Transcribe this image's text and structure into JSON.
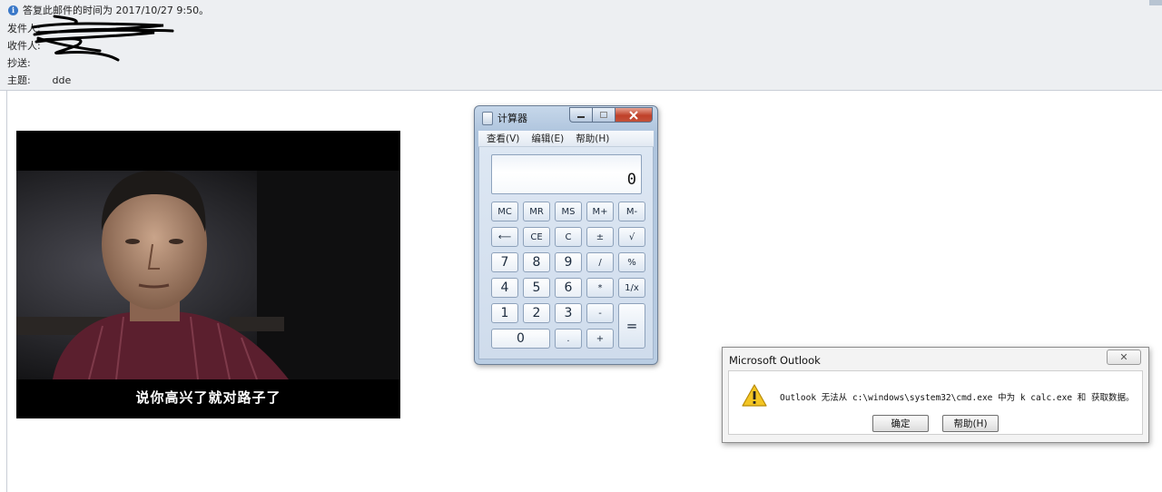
{
  "email": {
    "reply_notice": "答复此邮件的时间为 2017/10/27 9:50。",
    "from_label": "发件人:",
    "to_label": "收件人:",
    "cc_label": "抄送:",
    "subject_label": "主题:",
    "subject_value": "dde"
  },
  "image": {
    "subtitle": "说你高兴了就对路子了"
  },
  "calculator": {
    "title": "计算器",
    "menu": [
      "查看(V)",
      "编辑(E)",
      "帮助(H)"
    ],
    "display": "0",
    "keys": [
      "MC",
      "MR",
      "MS",
      "M+",
      "M-",
      "⟵",
      "CE",
      "C",
      "±",
      "√",
      "7",
      "8",
      "9",
      "/",
      "%",
      "4",
      "5",
      "6",
      "*",
      "1/x",
      "1",
      "2",
      "3",
      "-",
      "=",
      "0",
      ".",
      "+"
    ]
  },
  "dialog": {
    "title": "Microsoft Outlook",
    "message": "Outlook 无法从 c:\\windows\\system32\\cmd.exe 中为 k calc.exe 和  获取数据。",
    "ok_label": "确定",
    "help_label": "帮助(H)",
    "close_glyph": "✕"
  },
  "colors": {
    "header_bg": "#edeff2",
    "dialog_bg": "#f3f3f3",
    "calc_frame": "#b9cde3",
    "close_red": "#c0412a"
  },
  "icons": [
    "info-icon",
    "calculator-icon",
    "minimize-icon",
    "maximize-icon",
    "close-icon",
    "warning-icon"
  ]
}
